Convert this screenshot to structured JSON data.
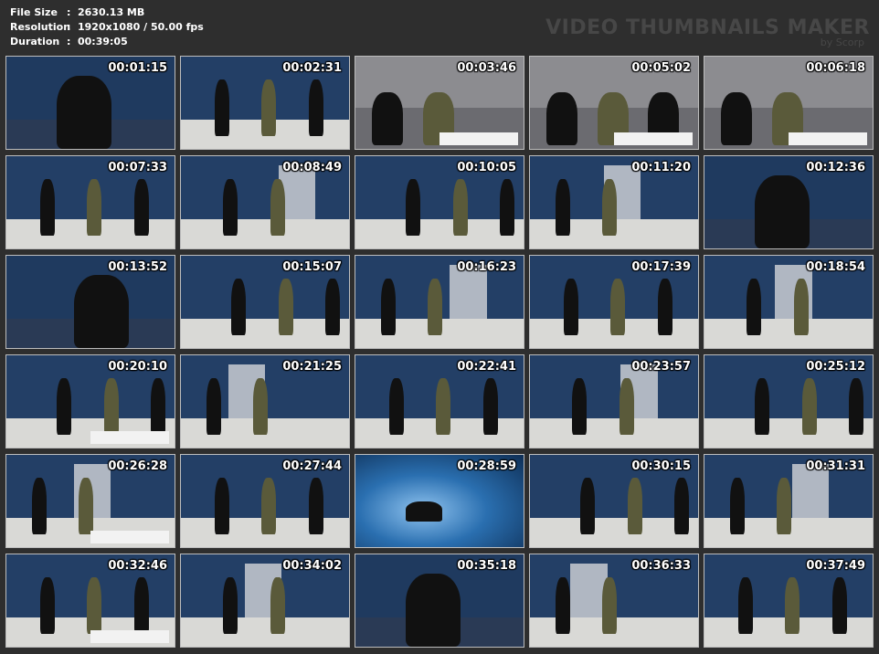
{
  "meta": [
    {
      "label": "File Size",
      "sep": ":",
      "value": "2630.13 MB"
    },
    {
      "label": "Resolution",
      "sep": ":",
      "value": "1920x1080 / 50.00 fps"
    },
    {
      "label": "Duration",
      "sep": ":",
      "value": "00:39:05"
    }
  ],
  "brand": {
    "title": "VIDEO THUMBNAILS MAKER",
    "sub": "by Scorp"
  },
  "thumbnails": [
    {
      "time": "00:01:15",
      "scene": "closeup"
    },
    {
      "time": "00:02:31",
      "scene": "studio"
    },
    {
      "time": "00:03:46",
      "scene": "sofa"
    },
    {
      "time": "00:05:02",
      "scene": "sofa"
    },
    {
      "time": "00:06:18",
      "scene": "sofa"
    },
    {
      "time": "00:07:33",
      "scene": "studio"
    },
    {
      "time": "00:08:49",
      "scene": "studio"
    },
    {
      "time": "00:10:05",
      "scene": "studio"
    },
    {
      "time": "00:11:20",
      "scene": "studio"
    },
    {
      "time": "00:12:36",
      "scene": "closeup"
    },
    {
      "time": "00:13:52",
      "scene": "closeup"
    },
    {
      "time": "00:15:07",
      "scene": "studio"
    },
    {
      "time": "00:16:23",
      "scene": "studio"
    },
    {
      "time": "00:17:39",
      "scene": "studio"
    },
    {
      "time": "00:18:54",
      "scene": "studio"
    },
    {
      "time": "00:20:10",
      "scene": "studio"
    },
    {
      "time": "00:21:25",
      "scene": "studio"
    },
    {
      "time": "00:22:41",
      "scene": "studio"
    },
    {
      "time": "00:23:57",
      "scene": "studio"
    },
    {
      "time": "00:25:12",
      "scene": "studio"
    },
    {
      "time": "00:26:28",
      "scene": "studio"
    },
    {
      "time": "00:27:44",
      "scene": "studio"
    },
    {
      "time": "00:28:59",
      "scene": "snow"
    },
    {
      "time": "00:30:15",
      "scene": "studio"
    },
    {
      "time": "00:31:31",
      "scene": "studio"
    },
    {
      "time": "00:32:46",
      "scene": "studio"
    },
    {
      "time": "00:34:02",
      "scene": "studio"
    },
    {
      "time": "00:35:18",
      "scene": "closeup"
    },
    {
      "time": "00:36:33",
      "scene": "studio"
    },
    {
      "time": "00:37:49",
      "scene": "studio"
    }
  ]
}
